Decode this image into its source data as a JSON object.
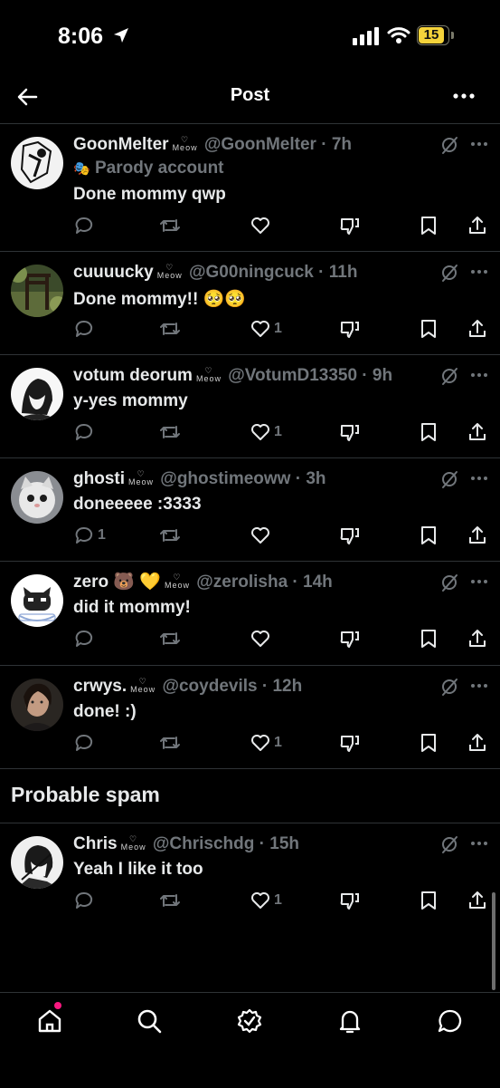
{
  "status_bar": {
    "time": "8:06",
    "battery": "15"
  },
  "header": {
    "title": "Post"
  },
  "tweets": [
    {
      "name": "GoonMelter",
      "meow": "Meow",
      "handle": "@GoonMelter",
      "time": "7h",
      "parody_label": "Parody account",
      "text": "Done mommy qwp",
      "likes": "",
      "replies": ""
    },
    {
      "name": "cuuuucky",
      "meow": "Meow",
      "handle": "@G00ningcuck",
      "time": "11h",
      "text": "Done mommy!! 🥺🥺",
      "likes": "1",
      "replies": ""
    },
    {
      "name": "votum deorum",
      "meow": "Meow",
      "handle": "@VotumD13350",
      "time": "9h",
      "text": "y-yes mommy",
      "likes": "1",
      "replies": ""
    },
    {
      "name": "ghosti",
      "meow": "Meow",
      "handle": "@ghostimeoww",
      "time": "3h",
      "text": "doneeeee :3333",
      "likes": "",
      "replies": "1"
    },
    {
      "name": "zero 🐻 💛",
      "meow": "Meow",
      "handle": "@zerolisha",
      "time": "14h",
      "text": "did it mommy!",
      "likes": "",
      "replies": ""
    },
    {
      "name": "crwys.",
      "meow": "Meow",
      "handle": "@coydevils",
      "time": "12h",
      "text": "done! :)",
      "likes": "1",
      "replies": ""
    },
    {
      "name": "Chris",
      "meow": "Meow",
      "handle": "@Chrischdg",
      "time": "15h",
      "text": "Yeah I like it too",
      "likes": "1",
      "replies": ""
    }
  ],
  "sections": {
    "probable_spam": "Probable spam"
  },
  "bottom_nav": [
    "home-icon",
    "search-icon",
    "verified-icon",
    "bell-icon",
    "messages-icon"
  ],
  "colors": {
    "background": "#000000",
    "text": "#e7e9ea",
    "muted": "#71767b",
    "divider": "#2f3336",
    "notification_dot": "#f91880",
    "battery": "#f5d33b"
  }
}
